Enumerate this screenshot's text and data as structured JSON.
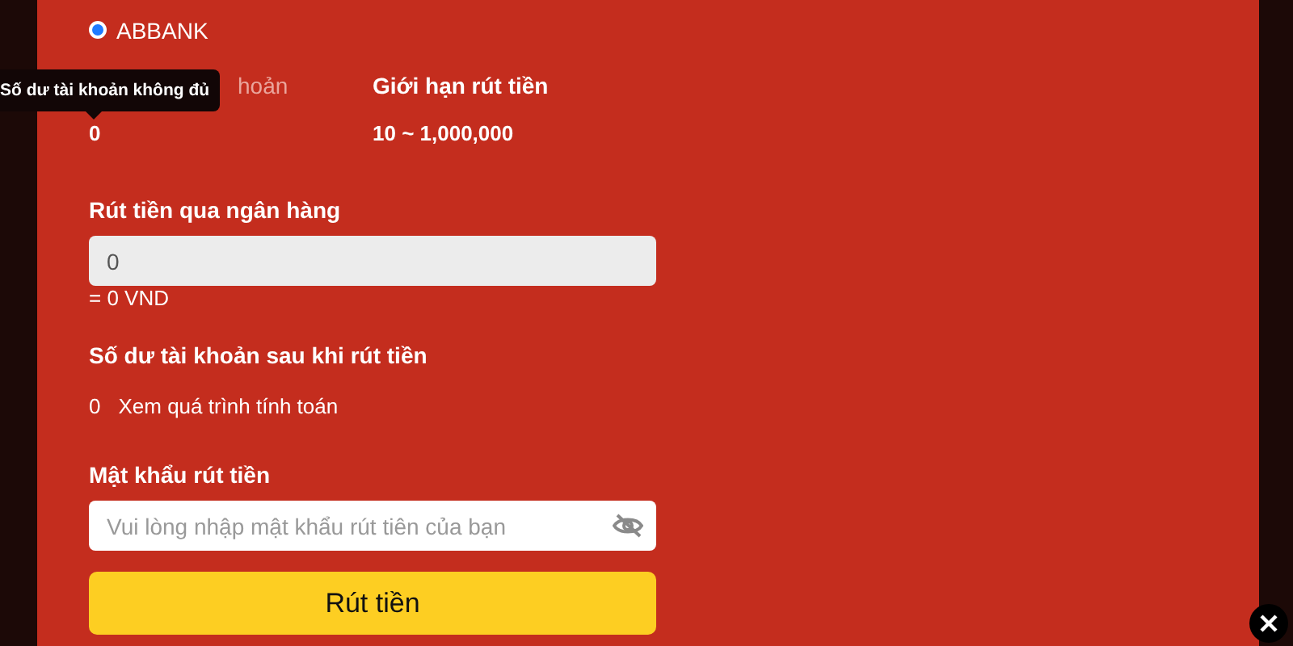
{
  "bank_option": {
    "label": "ABBANK",
    "selected": true
  },
  "info": [
    {
      "label": "hoản",
      "value": "0",
      "dimmed": true
    },
    {
      "label": "Giới hạn rút tiền",
      "value": "10 ~ 1,000,000",
      "dimmed": false
    }
  ],
  "tooltip": "Số dư tài khoản không đủ",
  "amount": {
    "label": "Rút tiền qua ngân hàng",
    "value": "0",
    "disabled": true,
    "converted": "= 0 VND"
  },
  "balance_after": {
    "label": "Số dư tài khoản sau khi rút tiền",
    "value": "0",
    "link": "Xem quá trình tính toán"
  },
  "password": {
    "label": "Mật khẩu rút tiền",
    "placeholder": "Vui lòng nhập mật khẩu rút tiên của bạn"
  },
  "submit": "Rút tiền"
}
